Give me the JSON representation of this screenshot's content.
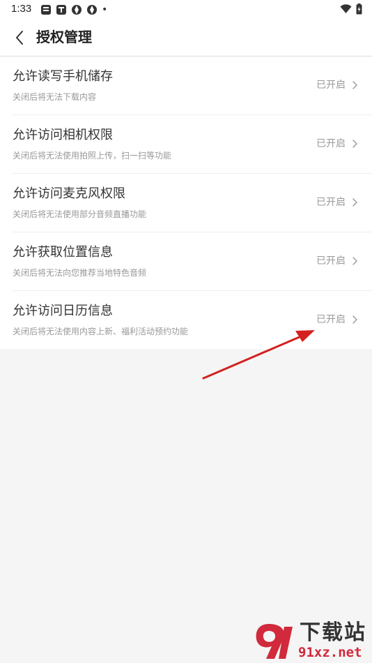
{
  "status_bar": {
    "time": "1:33",
    "dot": "•"
  },
  "header": {
    "title": "授权管理"
  },
  "permissions": [
    {
      "title": "允许读写手机储存",
      "desc": "关闭后将无法下载内容",
      "status": "已开启"
    },
    {
      "title": "允许访问相机权限",
      "desc": "关闭后将无法使用拍照上传，扫一扫等功能",
      "status": "已开启"
    },
    {
      "title": "允许访问麦克风权限",
      "desc": "关闭后将无法使用部分音频直播功能",
      "status": "已开启"
    },
    {
      "title": "允许获取位置信息",
      "desc": "关闭后将无法向您推荐当地特色音频",
      "status": "已开启"
    },
    {
      "title": "允许访问日历信息",
      "desc": "关闭后将无法使用内容上新、福利活动预约功能",
      "status": "已开启"
    }
  ],
  "watermark": {
    "top_text": "下载站",
    "bottom_text": "91xz.net"
  },
  "colors": {
    "arrow": "#d42020",
    "watermark_red": "#d02a3c"
  }
}
